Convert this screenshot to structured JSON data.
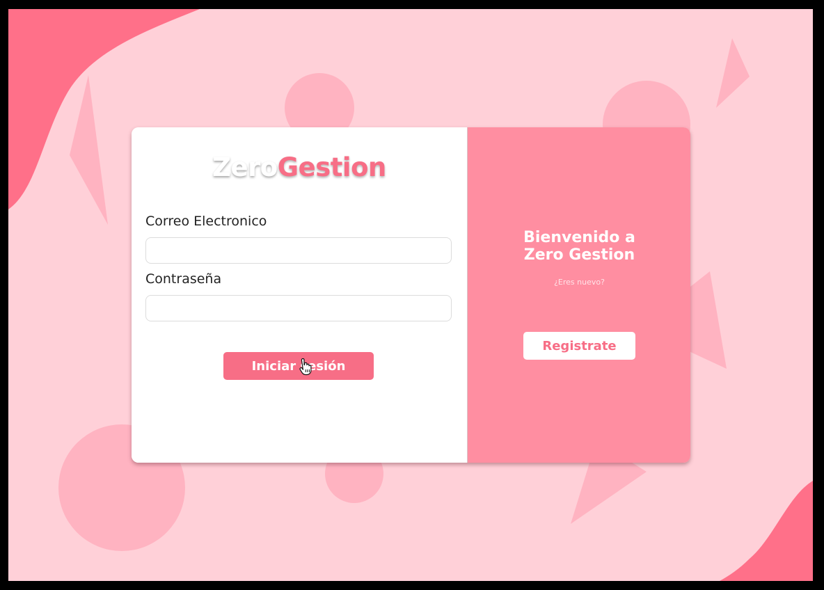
{
  "theme": {
    "accent": "#f76e86",
    "background": "#ffd0d8",
    "panel": "#ff8597"
  },
  "login": {
    "logo_part1": "Zero",
    "logo_part2": "Gestion",
    "email_label": "Correo Electronico",
    "email_value": "",
    "password_label": "Contraseña",
    "password_value": "",
    "submit_label": "Iniciar sesión"
  },
  "welcome": {
    "title_line1": "Bienvenido a",
    "title_line2": "Zero Gestion",
    "subtitle": "¿Eres nuevo?",
    "register_label": "Registrate"
  },
  "icons": {
    "cursor": "hand-pointer-icon"
  }
}
